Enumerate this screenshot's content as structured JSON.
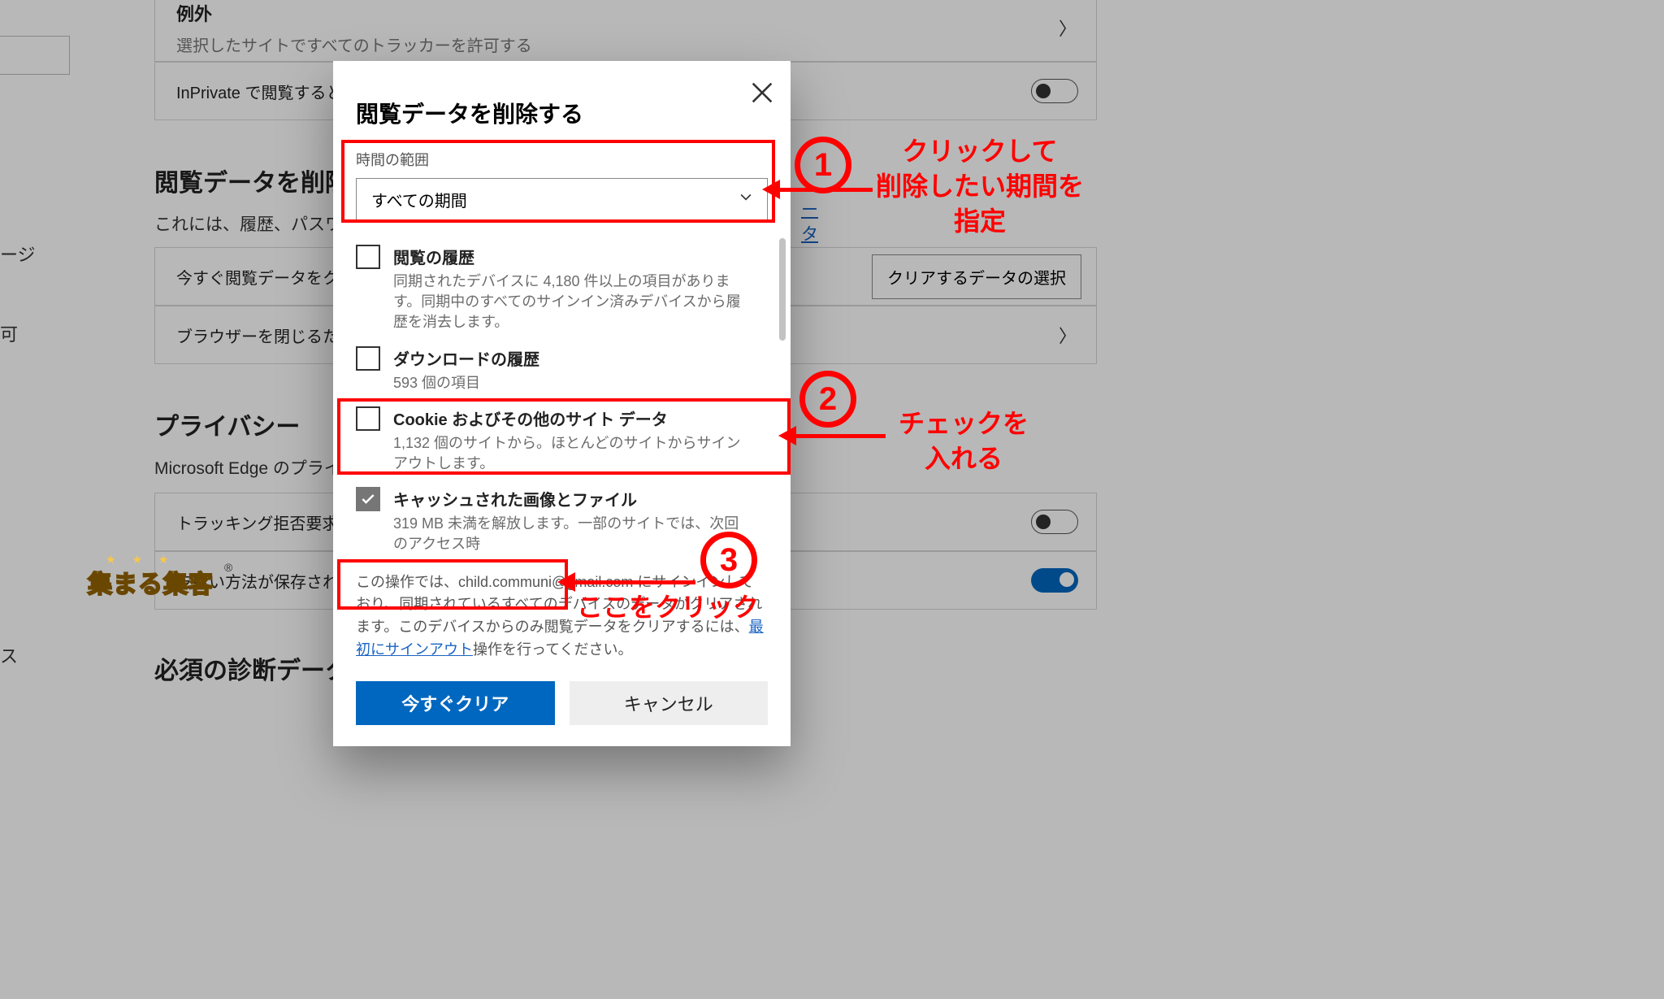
{
  "bg": {
    "left_frag_1": "ージ",
    "left_frag_2": "可",
    "left_frag_3": "ス",
    "exceptions_title": "例外",
    "exceptions_sub": "選択したサイトですべてのトラッカーを許可する",
    "inprivate_row": "InPrivate で閲覧すると",
    "section_clear_title": "閲覧データを削除",
    "section_clear_sub": "これには、履歴、パスワード",
    "data_manage_link": "ータの管理",
    "clear_now_row": "今すぐ閲覧データをク",
    "choose_button": "クリアするデータの選択",
    "close_browser_row": "ブラウザーを閉じるたびに",
    "privacy_title": "プライバシー",
    "privacy_sub": "Microsoft Edge のプライ",
    "dnt_row": "トラッキング拒否要求を",
    "payment_row": "支払い方法が保存され",
    "diag_title": "必須の診断データ"
  },
  "modal": {
    "title": "閲覧データを削除する",
    "time_label": "時間の範囲",
    "time_value": "すべての期間",
    "items": [
      {
        "title": "閲覧の履歴",
        "desc": "同期されたデバイスに 4,180 件以上の項目があります。同期中のすべてのサインイン済みデバイスから履歴を消去します。",
        "checked": false
      },
      {
        "title": "ダウンロードの履歴",
        "desc": "593 個の項目",
        "checked": false
      },
      {
        "title": "Cookie およびその他のサイト データ",
        "desc": "1,132 個のサイトから。ほとんどのサイトからサインアウトします。",
        "checked": false
      },
      {
        "title": "キャッシュされた画像とファイル",
        "desc": "319 MB 未満を解放します。一部のサイトでは、次回のアクセス時",
        "checked": true
      }
    ],
    "note_pre": "この操作では、child.communi@gmail.com にサインインしており、同期されているすべてのデバイスのデータがクリアされます。このデバイスからのみ閲覧データをクリアするには、",
    "note_link": "最初にサインアウト",
    "note_post": "操作を行ってください。",
    "primary": "今すぐクリア",
    "secondary": "キャンセル"
  },
  "anno": {
    "n1": "1",
    "n2": "2",
    "n3": "3",
    "t1": "クリックして\n削除したい期間を\n指定",
    "t2": "チェックを\n入れる",
    "t3": "ここをクリック"
  },
  "watermark": {
    "text": "集まる集客",
    "reg": "®"
  }
}
